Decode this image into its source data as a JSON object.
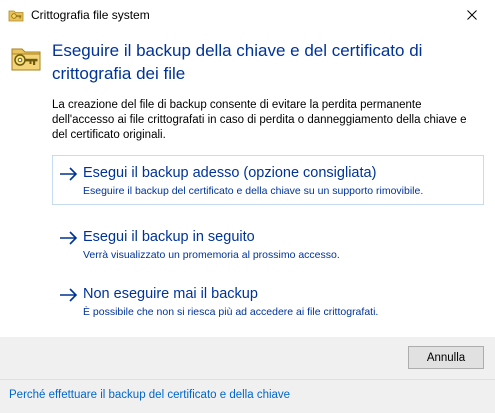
{
  "window": {
    "title": "Crittografia file system",
    "close_icon": "close-icon"
  },
  "header": {
    "title": "Eseguire il backup della chiave e del certificato di crittografia dei file",
    "icon": "folder-key-icon"
  },
  "description": "La creazione del file di backup consente di evitare la perdita permanente dell'accesso ai file crittografati in caso di perdita o danneggiamento della chiave e del certificato originali.",
  "options": [
    {
      "title": "Esegui il backup adesso (opzione consigliata)",
      "subtitle": "Eseguire il backup del certificato e della chiave su un supporto rimovibile."
    },
    {
      "title": "Esegui il backup in seguito",
      "subtitle": "Verrà visualizzato un promemoria al prossimo accesso."
    },
    {
      "title": "Non eseguire mai il backup",
      "subtitle": "È possibile che non si riesca più ad accedere ai file crittografati."
    }
  ],
  "buttons": {
    "cancel": "Annulla"
  },
  "footer": {
    "link": "Perché effettuare il backup del certificato e della chiave"
  },
  "colors": {
    "accent": "#003399",
    "link": "#0066cc",
    "selected_border": "#c6dcef"
  }
}
